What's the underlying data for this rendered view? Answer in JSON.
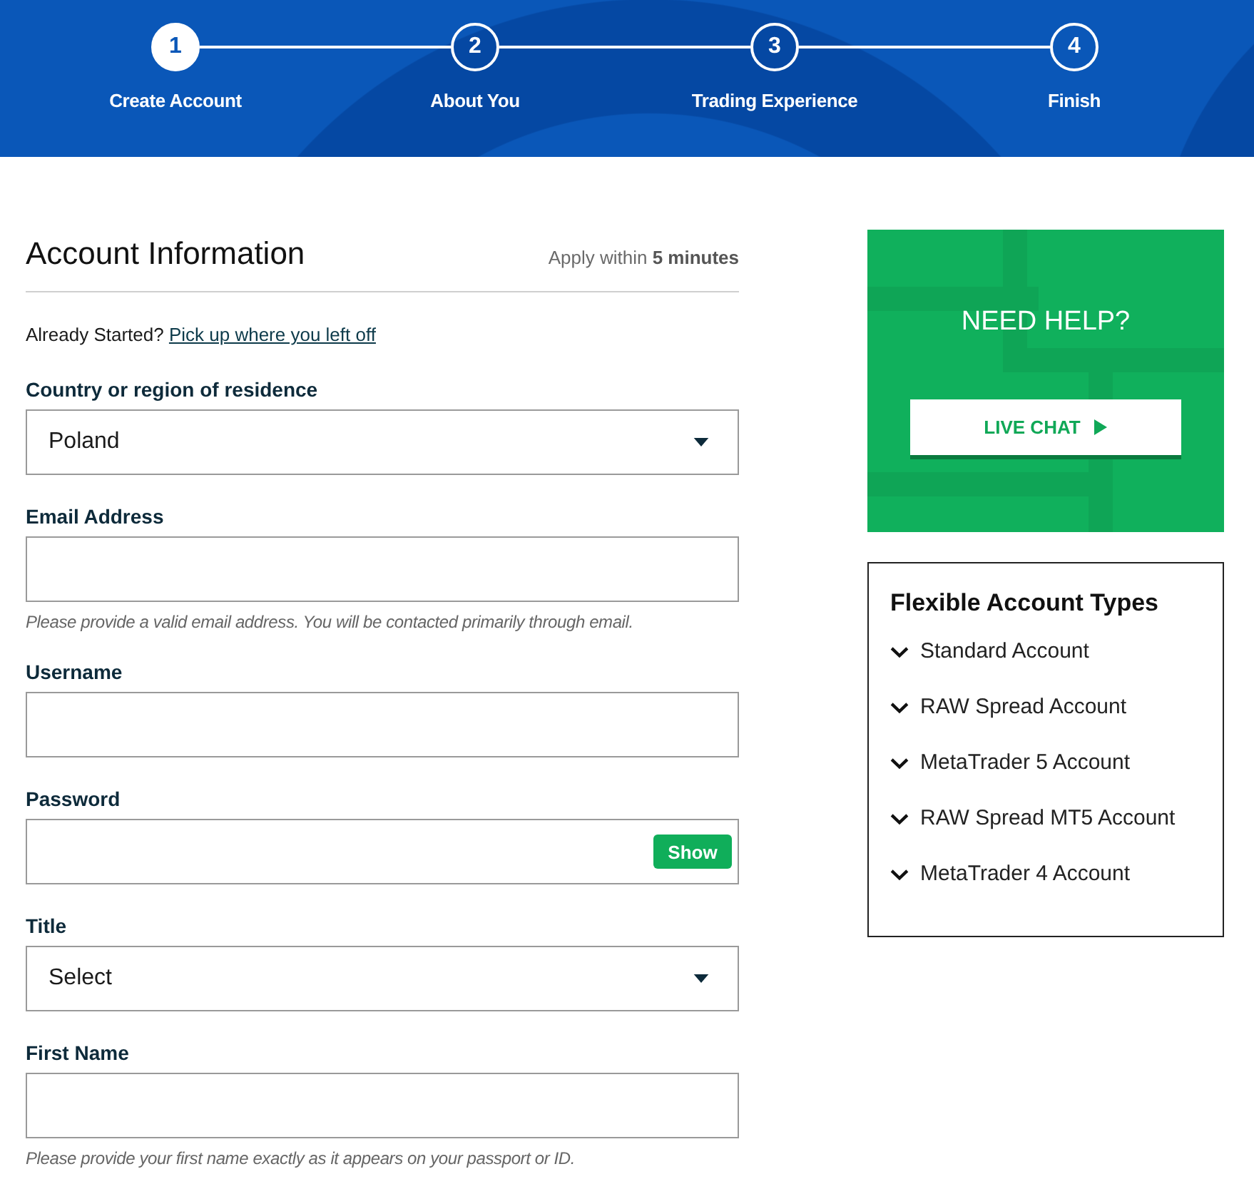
{
  "steps": [
    {
      "number": "1",
      "label": "Create Account",
      "selected": true
    },
    {
      "number": "2",
      "label": "About You",
      "selected": false
    },
    {
      "number": "3",
      "label": "Trading Experience",
      "selected": false
    },
    {
      "number": "4",
      "label": "Finish",
      "selected": false
    }
  ],
  "form": {
    "title": "Account Information",
    "note": "Apply within **5 minutes**",
    "resume": {
      "prompt": "Already Started?",
      "link": "Pick up where you left off"
    },
    "fields": [
      {
        "kind": "select",
        "label": "Country or region of residence",
        "value": "Poland"
      },
      {
        "kind": "text",
        "label": "Email Address",
        "hint": "Please provide a valid email address. You will be contacted primarily through email."
      },
      {
        "kind": "text",
        "label": "Username"
      },
      {
        "kind": "password",
        "label": "Password",
        "toggle": "Show"
      },
      {
        "kind": "select",
        "label": "Title",
        "value": "Select"
      },
      {
        "kind": "text",
        "label": "First Name",
        "hint": "Please provide your first name exactly as it appears on your passport or ID."
      }
    ]
  },
  "help": {
    "title": "NEED HELP?",
    "button": "LIVE CHAT"
  },
  "account_types": {
    "title": "Flexible Account Types",
    "items": [
      {
        "label": "Standard Account",
        "expanded": false
      },
      {
        "label": "RAW Spread Account",
        "expanded": false
      },
      {
        "label": "MetaTrader 5 Account",
        "expanded": false
      },
      {
        "label": "RAW Spread MT5 Account",
        "expanded": false
      },
      {
        "label": "MetaTrader 4 Account",
        "expanded": false
      }
    ]
  }
}
